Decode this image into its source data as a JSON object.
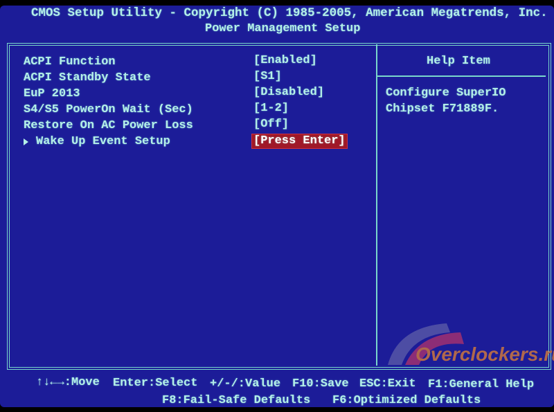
{
  "header": {
    "title": "CMOS Setup Utility - Copyright (C) 1985-2005, American Megatrends, Inc.",
    "subtitle": "Power Management Setup"
  },
  "settings": [
    {
      "label": "ACPI Function",
      "value": "[Enabled]"
    },
    {
      "label": "ACPI Standby State",
      "value": "[S1]"
    },
    {
      "label": "EuP 2013",
      "value": "[Disabled]"
    },
    {
      "label": "S4/S5 PowerOn Wait (Sec)",
      "value": "[1-2]"
    },
    {
      "label": "Restore On AC Power Loss",
      "value": "[Off]"
    },
    {
      "label": "Wake Up Event Setup",
      "value": "[Press Enter]",
      "selected": true
    }
  ],
  "help": {
    "title": "Help Item",
    "lines": [
      "Configure SuperIO",
      "Chipset F71889F."
    ]
  },
  "footer": {
    "row1": [
      "↑↓←→:Move",
      "Enter:Select",
      "+/-/:Value",
      "F10:Save",
      "ESC:Exit",
      "F1:General Help"
    ],
    "row2": [
      "F8:Fail-Safe Defaults",
      "F6:Optimized Defaults"
    ]
  },
  "watermark": "Overclockers.ru",
  "colors": {
    "background": "#1c1c98",
    "text": "#b4f0e8",
    "highlight": "#a01828"
  }
}
